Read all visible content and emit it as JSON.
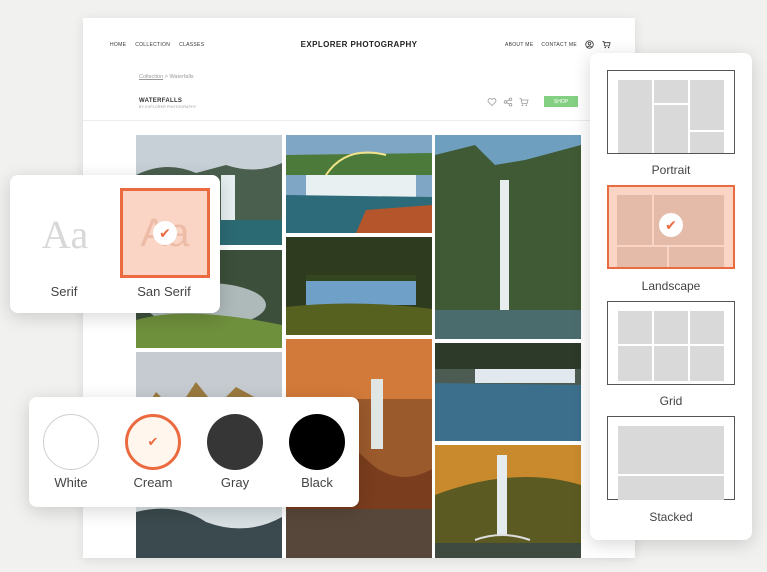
{
  "site": {
    "nav_left": [
      "HOME",
      "COLLECTION",
      "CLASSES"
    ],
    "brand": "EXPLORER PHOTOGRAPHY",
    "nav_right": [
      "ABOUT ME",
      "CONTACT ME"
    ],
    "icons": [
      "user-icon",
      "cart-icon"
    ],
    "breadcrumb": {
      "link": "Collection",
      "separator": ">",
      "current": "Waterfalls"
    },
    "gallery_title": "WATERFALLS",
    "gallery_subtitle": "BY EXPLORER PHOTOGRAPHY",
    "actions": [
      "heart-icon",
      "share-icon",
      "cart-icon"
    ],
    "shop_label": "SHOP"
  },
  "fonts": {
    "sample_text": "Aa",
    "options": [
      {
        "label": "Serif",
        "selected": false
      },
      {
        "label": "San Serif",
        "selected": true
      }
    ]
  },
  "colors": {
    "options": [
      {
        "label": "White",
        "hex": "#ffffff",
        "selected": false
      },
      {
        "label": "Cream",
        "hex": "#fff6ee",
        "selected": true
      },
      {
        "label": "Gray",
        "hex": "#363636",
        "selected": false
      },
      {
        "label": "Black",
        "hex": "#000000",
        "selected": false
      }
    ],
    "accent": "#ec6a3f"
  },
  "layouts": {
    "options": [
      {
        "label": "Portrait",
        "selected": false
      },
      {
        "label": "Landscape",
        "selected": true
      },
      {
        "label": "Grid",
        "selected": false
      },
      {
        "label": "Stacked",
        "selected": false
      }
    ]
  },
  "check_glyph": "✔"
}
